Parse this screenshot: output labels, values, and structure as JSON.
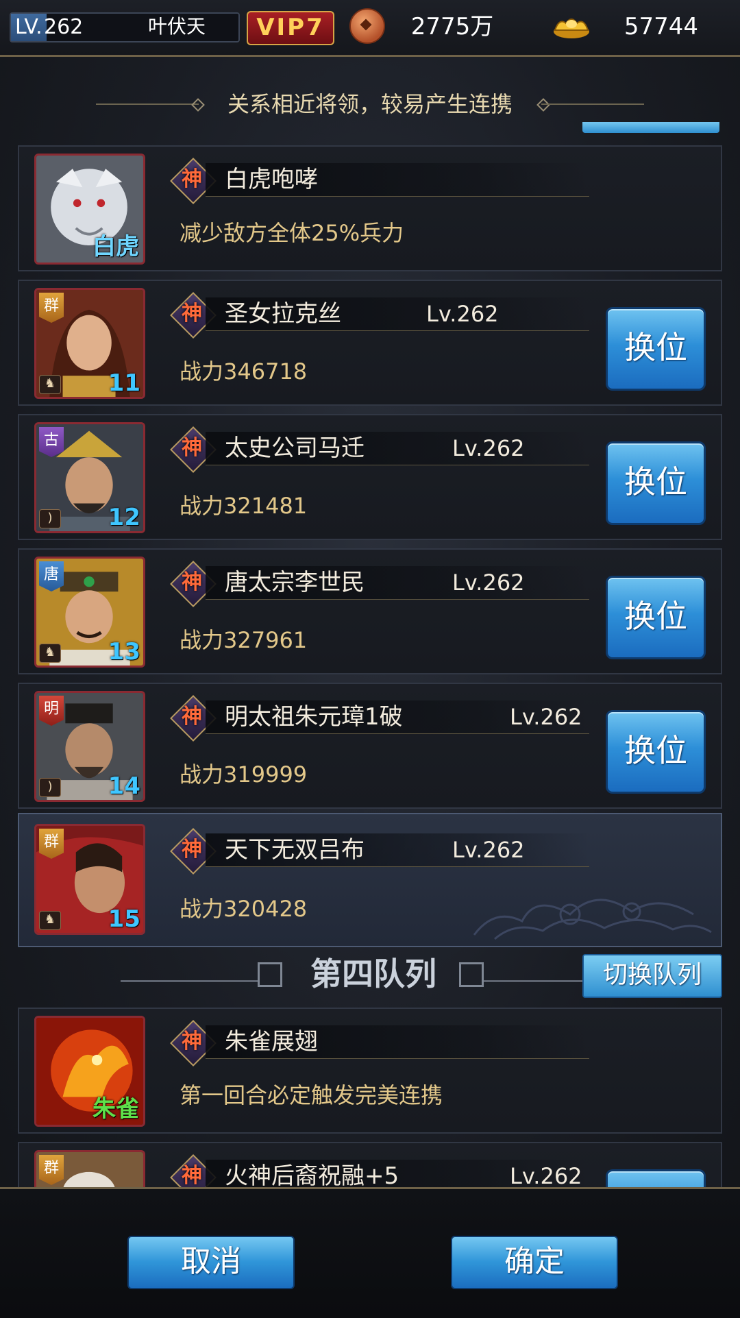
{
  "topbar": {
    "lv_label": "LV.",
    "lv_value": "262",
    "player_name": "叶伏天",
    "vip": "VIP7",
    "copper": "2775万",
    "gold": "57744"
  },
  "hint": "关系相近将领，较易产生连携",
  "rows": [
    {
      "type": "beast",
      "beast": "白虎",
      "skill_badge": "神",
      "skill": "白虎咆哮",
      "desc": "减少敌方全体25%兵力"
    },
    {
      "type": "hero",
      "faction": "群",
      "badge": "神",
      "name": "圣女拉克丝",
      "level": "Lv.262",
      "power": "战力346718",
      "slot": "11",
      "button": "换位"
    },
    {
      "type": "hero",
      "faction": "古",
      "badge": "神",
      "name": "太史公司马迁",
      "level": "Lv.262",
      "power": "战力321481",
      "slot": "12",
      "button": "换位"
    },
    {
      "type": "hero",
      "faction": "唐",
      "badge": "神",
      "name": "唐太宗李世民",
      "level": "Lv.262",
      "power": "战力327961",
      "slot": "13",
      "button": "换位"
    },
    {
      "type": "hero",
      "faction": "明",
      "badge": "神",
      "name": "明太祖朱元璋1破",
      "level": "Lv.262",
      "power": "战力319999",
      "slot": "14",
      "button": "换位"
    },
    {
      "type": "hero",
      "faction": "群",
      "badge": "神",
      "name": "天下无双吕布",
      "level": "Lv.262",
      "power": "战力320428",
      "slot": "15"
    }
  ],
  "section": {
    "title": "第四队列",
    "switch": "切换队列"
  },
  "row2": {
    "type": "beast",
    "beast": "朱雀",
    "skill_badge": "神",
    "skill": "朱雀展翅",
    "desc": "第一回合必定触发完美连携"
  },
  "partial_row": {
    "faction": "群",
    "badge": "神",
    "name": "火神后裔祝融+5",
    "level": "Lv.262"
  },
  "buttons": {
    "cancel": "取消",
    "confirm": "确定"
  }
}
